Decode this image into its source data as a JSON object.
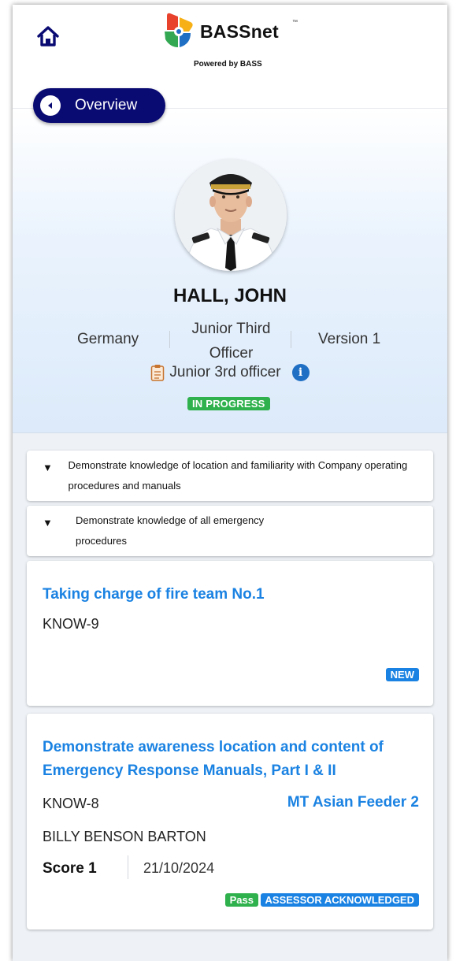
{
  "app": {
    "logo_text": "BASSnet",
    "logo_tm": "™",
    "logo_sub": "Powered by BASS"
  },
  "nav": {
    "overview_label": "Overview"
  },
  "profile": {
    "name": "HALL, JOHN",
    "country": "Germany",
    "rank": "Junior Third Officer",
    "version": "Version 1",
    "role": "Junior 3rd officer",
    "status": "IN PROGRESS",
    "status_color": "#2fb14d"
  },
  "sections": [
    {
      "label": "Demonstrate knowledge of location and familiarity with Company operating procedures and manuals"
    },
    {
      "label": "Demonstrate knowledge of all emergency procedures"
    }
  ],
  "tasks": [
    {
      "title": "Taking charge of fire team No.1",
      "code": "KNOW-9",
      "badges": [
        "NEW"
      ]
    },
    {
      "title": "Demonstrate awareness location and content of Emergency Response Manuals, Part I & II",
      "code": "KNOW-8",
      "vessel": "MT Asian Feeder 2",
      "assessor": "BILLY BENSON BARTON",
      "score": "Score 1",
      "date": "21/10/2024",
      "badges": [
        "Pass",
        "ASSESSOR ACKNOWLEDGED"
      ]
    }
  ],
  "colors": {
    "accent": "#1a82e2",
    "nav_button": "#0a0a73",
    "success": "#2fb14d"
  }
}
